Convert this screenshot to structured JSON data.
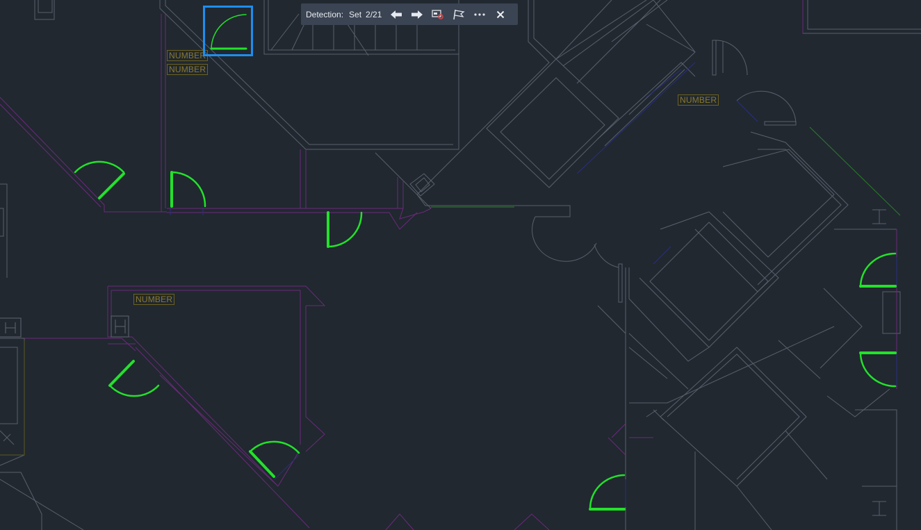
{
  "toolbar": {
    "detection_label": "Detection:",
    "set_label": "Set",
    "count": "2/21",
    "buttons": {
      "previous": "arrow-left-icon",
      "next": "arrow-right-icon",
      "zoom_to": "zoom-selection-icon",
      "flag": "flag-icon",
      "more": "more-icon",
      "close": "close-icon"
    }
  },
  "drawing": {
    "tags": [
      "NUMBER",
      "NUMBER",
      "NUMBER",
      "NUMBER"
    ],
    "colors": {
      "background": "#212830",
      "walls": "#5f6670",
      "partitions": "#6a2a78",
      "detected_doors": "#22e22a",
      "selection": "#1d8ef0",
      "labels": "#8a7a2a"
    }
  }
}
